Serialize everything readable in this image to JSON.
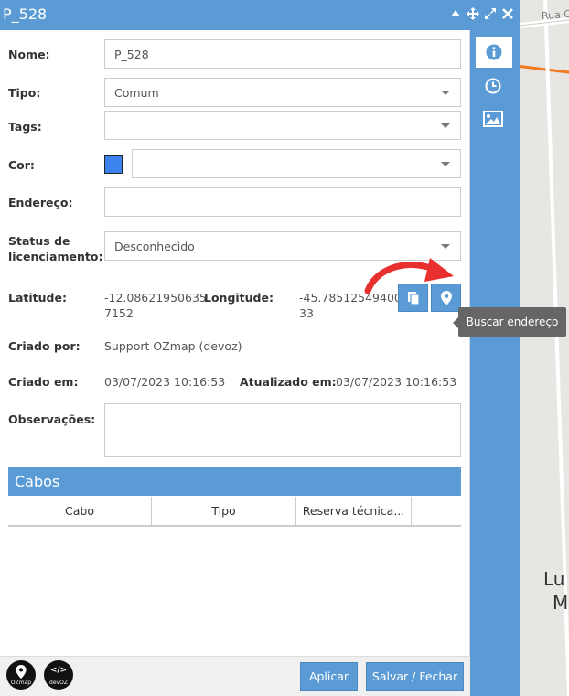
{
  "map": {
    "street_label": "Rua C",
    "place_label_line1": "Lu",
    "place_label_line2": "M"
  },
  "header": {
    "title": "P_528"
  },
  "form": {
    "nome_label": "Nome:",
    "nome_value": "P_528",
    "tipo_label": "Tipo:",
    "tipo_value": "Comum",
    "tags_label": "Tags:",
    "tags_value": "",
    "cor_label": "Cor:",
    "cor_color": "#3c83f0",
    "cor_value": "",
    "endereco_label": "Endereço:",
    "endereco_value": "",
    "status_label_line1": "Status de",
    "status_label_line2": "licenciamento:",
    "status_value": "Desconhecido",
    "latitude_label": "Latitude:",
    "latitude_line1": "-12.08621950635",
    "latitude_line2": "7152",
    "longitude_label": "Longitude:",
    "longitude_line1": "-45.78512549400",
    "longitude_line2": "33",
    "criado_por_label": "Criado por:",
    "criado_por_value": "Support OZmap (devoz)",
    "criado_em_label": "Criado em:",
    "criado_em_value": "03/07/2023 10:16:53",
    "atualizado_em_label": "Atualizado em:",
    "atualizado_em_value": "03/07/2023 10:16:53",
    "observacoes_label": "Observações:",
    "observacoes_value": ""
  },
  "tooltip": {
    "text": "Buscar endereço"
  },
  "cabos": {
    "title": "Cabos",
    "columns": [
      "Cabo",
      "Tipo",
      "Reserva técnica..."
    ]
  },
  "footer": {
    "logo1": "OZmap",
    "logo2": "devOZ",
    "apply_label": "Aplicar",
    "save_close_label": "Salvar / Fechar"
  },
  "colors": {
    "accent": "#5b9bd5",
    "arrow": "#e8312f"
  }
}
